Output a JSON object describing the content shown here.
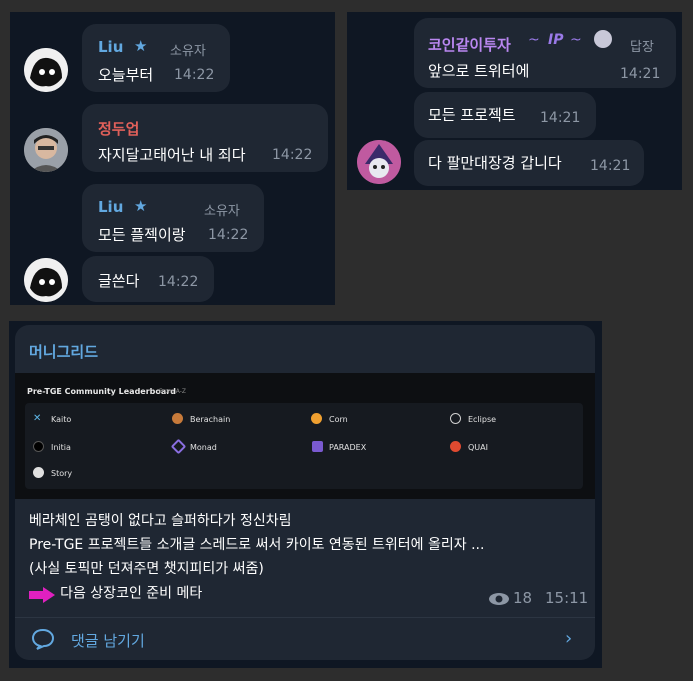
{
  "left_chat": {
    "messages": [
      {
        "name": "Liu",
        "role": "소유자",
        "text": "오늘부터",
        "time": "14:22"
      },
      {
        "name": "정두업",
        "text": "자지달고태어난 내 죄다",
        "time": "14:22"
      },
      {
        "name": "Liu",
        "role": "소유자",
        "text": "모든 플젝이랑",
        "time": "14:22"
      },
      {
        "text": "글쓴다",
        "time": "14:22"
      }
    ]
  },
  "right_chat": {
    "messages": [
      {
        "name": "코인같이투자",
        "badge": "IP",
        "role": "답장",
        "text": "앞으로 트위터에",
        "time": "14:21"
      },
      {
        "text": "모든 프로젝트",
        "time": "14:21"
      },
      {
        "text": "다 팔만대장경 갑니다",
        "time": "14:21"
      }
    ]
  },
  "post": {
    "channel": "머니그리드",
    "leaderboard": {
      "title": "Pre-TGE Community Leaderboard",
      "sort": "From A-Z",
      "items": [
        {
          "label": "Kaito",
          "color": "#5fb8e8"
        },
        {
          "label": "Berachain",
          "color": "#c77a3a"
        },
        {
          "label": "Corn",
          "color": "#f0a030"
        },
        {
          "label": "Eclipse",
          "color": "#d0d0d0"
        },
        {
          "label": "Initia",
          "color": "#e0e0e0"
        },
        {
          "label": "Monad",
          "color": "#8a6ee0"
        },
        {
          "label": "PARADEX",
          "color": "#7a5ad0"
        },
        {
          "label": "QUAI",
          "color": "#e04a30"
        },
        {
          "label": "Story",
          "color": "#e0e0e0"
        }
      ]
    },
    "lines": [
      "베라체인 곰탱이 없다고 슬퍼하다가 정신차림",
      "Pre-TGE 프로젝트들 소개글 스레드로 써서 카이토 연동된 트위터에 올리자 ...",
      "(사실 토픽만 던져주면 챗지피티가 써줌)",
      "다음 상장코인 준비 메타"
    ],
    "views": "18",
    "time": "15:11",
    "comment_label": "댓글 남기기"
  },
  "colors": {
    "liu": "#62a8e0",
    "jung": "#e0605a",
    "coin": "#b987f0",
    "accent_arrow": "#e020c0"
  }
}
